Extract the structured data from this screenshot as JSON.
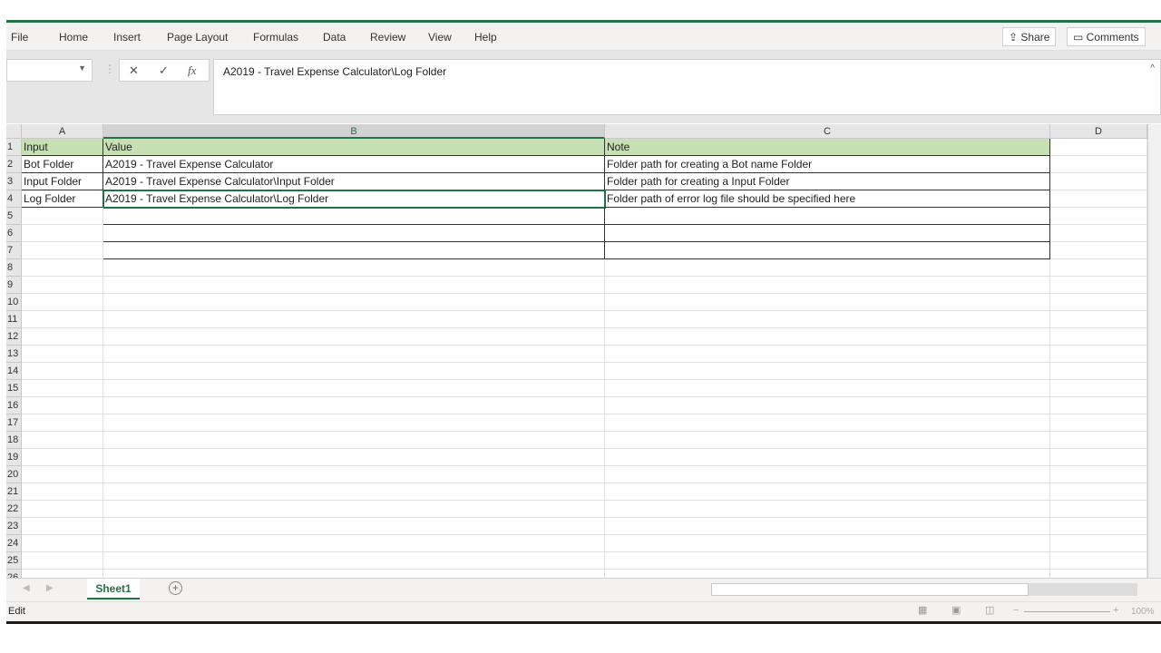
{
  "menu": [
    "File",
    "Home",
    "Insert",
    "Page Layout",
    "Formulas",
    "Data",
    "Review",
    "View",
    "Help"
  ],
  "share_label": "Share",
  "comments_label": "Comments",
  "formula": {
    "name_box": "",
    "cancel": "✕",
    "enter": "✓",
    "fx": "fx",
    "value": "A2019 - Travel Expense Calculator\\Log Folder"
  },
  "columns": [
    "A",
    "B",
    "C",
    "D"
  ],
  "rows": [
    [
      "Input",
      "Value",
      "Note",
      ""
    ],
    [
      "Bot Folder",
      "A2019 - Travel Expense Calculator",
      "Folder path  for creating a Bot name Folder",
      ""
    ],
    [
      "Input Folder",
      "A2019 - Travel Expense Calculator\\Input Folder",
      "Folder path  for creating a Input Folder",
      ""
    ],
    [
      "Log Folder",
      "A2019 - Travel Expense Calculator\\Log Folder",
      "Folder path of error log file should be specified here",
      ""
    ]
  ],
  "row_count": 26,
  "selected_cell": "B4",
  "sheet_tab": "Sheet1",
  "status": "Edit",
  "zoom": "100%",
  "accent": "#217346"
}
